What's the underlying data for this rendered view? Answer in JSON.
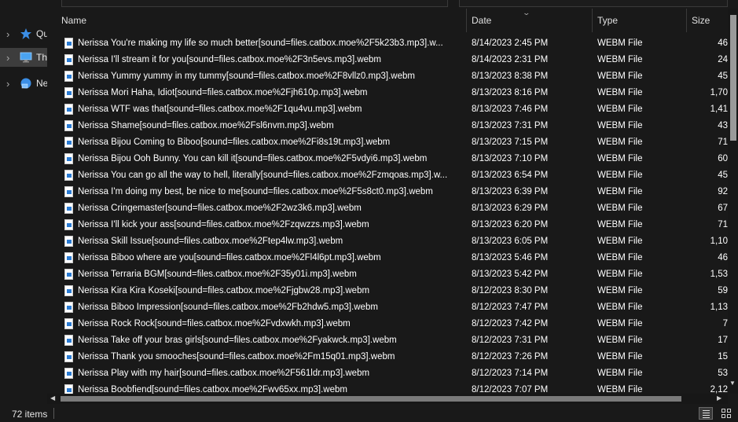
{
  "nav": {
    "items": [
      {
        "label": "Qu",
        "icon": "star-icon"
      },
      {
        "label": "Th",
        "icon": "pc-icon"
      },
      {
        "label": "Ne",
        "icon": "network-icon"
      }
    ]
  },
  "columns": {
    "name": "Name",
    "date": "Date",
    "type": "Type",
    "size": "Size"
  },
  "files": [
    {
      "name": "Nerissa You're making my life so much better[sound=files.catbox.moe%2F5k23b3.mp3].w...",
      "date": "8/14/2023 2:45 PM",
      "type": "WEBM File",
      "size": "46"
    },
    {
      "name": "Nerissa I'll stream it for you[sound=files.catbox.moe%2F3n5evs.mp3].webm",
      "date": "8/14/2023 2:31 PM",
      "type": "WEBM File",
      "size": "24"
    },
    {
      "name": "Nerissa Yummy yummy in my tummy[sound=files.catbox.moe%2F8vllz0.mp3].webm",
      "date": "8/13/2023 8:38 PM",
      "type": "WEBM File",
      "size": "45"
    },
    {
      "name": "Nerissa Mori Haha, Idiot[sound=files.catbox.moe%2Fjh610p.mp3].webm",
      "date": "8/13/2023 8:16 PM",
      "type": "WEBM File",
      "size": "1,70"
    },
    {
      "name": "Nerissa WTF was that[sound=files.catbox.moe%2F1qu4vu.mp3].webm",
      "date": "8/13/2023 7:46 PM",
      "type": "WEBM File",
      "size": "1,41"
    },
    {
      "name": "Nerissa Shame[sound=files.catbox.moe%2Fsl6nvm.mp3].webm",
      "date": "8/13/2023 7:31 PM",
      "type": "WEBM File",
      "size": "43"
    },
    {
      "name": "Nerissa Bijou Coming to Biboo[sound=files.catbox.moe%2Fi8s19t.mp3].webm",
      "date": "8/13/2023 7:15 PM",
      "type": "WEBM File",
      "size": "71"
    },
    {
      "name": "Nerissa Bijou Ooh Bunny. You can kill it[sound=files.catbox.moe%2F5vdyi6.mp3].webm",
      "date": "8/13/2023 7:10 PM",
      "type": "WEBM File",
      "size": "60"
    },
    {
      "name": "Nerissa You can go all the way to hell, literally[sound=files.catbox.moe%2Fzmqoas.mp3].w...",
      "date": "8/13/2023 6:54 PM",
      "type": "WEBM File",
      "size": "45"
    },
    {
      "name": "Nerissa I'm doing my best, be nice to me[sound=files.catbox.moe%2F5s8ct0.mp3].webm",
      "date": "8/13/2023 6:39 PM",
      "type": "WEBM File",
      "size": "92"
    },
    {
      "name": "Nerissa Cringemaster[sound=files.catbox.moe%2F2wz3k6.mp3].webm",
      "date": "8/13/2023 6:29 PM",
      "type": "WEBM File",
      "size": "67"
    },
    {
      "name": "Nerissa I'll kick your ass[sound=files.catbox.moe%2Fzqwzzs.mp3].webm",
      "date": "8/13/2023 6:20 PM",
      "type": "WEBM File",
      "size": "71"
    },
    {
      "name": "Nerissa Skill Issue[sound=files.catbox.moe%2Ftep4lw.mp3].webm",
      "date": "8/13/2023 6:05 PM",
      "type": "WEBM File",
      "size": "1,10"
    },
    {
      "name": "Nerissa Biboo where are you[sound=files.catbox.moe%2Fl4l6pt.mp3].webm",
      "date": "8/13/2023 5:46 PM",
      "type": "WEBM File",
      "size": "46"
    },
    {
      "name": "Nerissa Terraria BGM[sound=files.catbox.moe%2F35y01i.mp3].webm",
      "date": "8/13/2023 5:42 PM",
      "type": "WEBM File",
      "size": "1,53"
    },
    {
      "name": "Nerissa Kira Kira Koseki[sound=files.catbox.moe%2Fjgbw28.mp3].webm",
      "date": "8/12/2023 8:30 PM",
      "type": "WEBM File",
      "size": "59"
    },
    {
      "name": "Nerissa Biboo Impression[sound=files.catbox.moe%2Fb2hdw5.mp3].webm",
      "date": "8/12/2023 7:47 PM",
      "type": "WEBM File",
      "size": "1,13"
    },
    {
      "name": "Nerissa Rock Rock[sound=files.catbox.moe%2Fvdxwkh.mp3].webm",
      "date": "8/12/2023 7:42 PM",
      "type": "WEBM File",
      "size": "7"
    },
    {
      "name": "Nerissa Take off your bras girls[sound=files.catbox.moe%2Fyakwck.mp3].webm",
      "date": "8/12/2023 7:31 PM",
      "type": "WEBM File",
      "size": "17"
    },
    {
      "name": "Nerissa Thank you smooches[sound=files.catbox.moe%2Fm15q01.mp3].webm",
      "date": "8/12/2023 7:26 PM",
      "type": "WEBM File",
      "size": "15"
    },
    {
      "name": "Nerissa Play with my hair[sound=files.catbox.moe%2F561ldr.mp3].webm",
      "date": "8/12/2023 7:14 PM",
      "type": "WEBM File",
      "size": "53"
    },
    {
      "name": "Nerissa Boobfiend[sound=files.catbox.moe%2Fwv65xx.mp3].webm",
      "date": "8/12/2023 7:07 PM",
      "type": "WEBM File",
      "size": "2,12"
    }
  ],
  "status": {
    "item_count": "72 items"
  }
}
